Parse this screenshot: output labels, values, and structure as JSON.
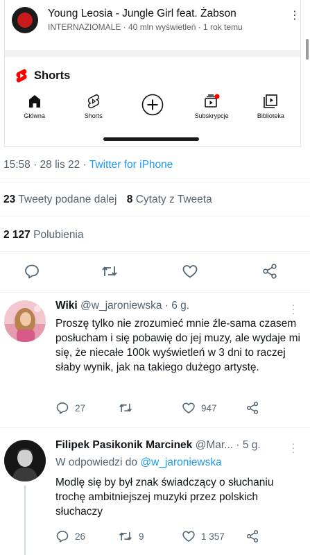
{
  "youtube": {
    "video_title": "Young Leosia - Jungle Girl feat. Żabson",
    "video_meta": "INTERNAZIOMALE · 40 mln wyświetleń · 1 rok temu",
    "shorts_label": "Shorts",
    "nav": [
      {
        "label": "Główna",
        "icon": "home-icon"
      },
      {
        "label": "Shorts",
        "icon": "shorts-icon"
      },
      {
        "label": "",
        "icon": "create-plus-icon"
      },
      {
        "label": "Subskrypcje",
        "icon": "subscriptions-icon"
      },
      {
        "label": "Biblioteka",
        "icon": "library-icon"
      }
    ]
  },
  "tweet": {
    "timestamp": "15:58 · 28 lis 22 · ",
    "source": "Twitter for iPhone",
    "retweets_count": "23",
    "retweets_label": "Tweety podane dalej",
    "quotes_count": "8",
    "quotes_label": "Cytaty z Tweeta",
    "likes_count": "2 127",
    "likes_label": "Polubienia"
  },
  "replies": [
    {
      "name": "Wiki",
      "handle": "@w_jaroniewska · 6 g.",
      "text": "Proszę tylko nie zrozumieć mnie źle-sama czasem posłucham i się pobawię do jej muzy, ale wydaje mi się, że niecałe 100k wyświetleń w 3 dni to raczej słaby wynik, jak na takiego dużego artystę.",
      "replies": "27",
      "retweets": "",
      "likes": "947"
    },
    {
      "name": "Filipek Pasikonik Marcinek",
      "handle": "@Mar... · 5 g.",
      "replying_prefix": "W odpowiedzi do ",
      "replying_to": "@w_jaroniewska",
      "text": "Modlę się by był znak świadczący o słuchaniu trochę ambitniejszej muzyki przez polskich słuchaczy",
      "replies": "26",
      "retweets": "9",
      "likes": "1 357"
    }
  ],
  "colors": {
    "accent": "#1d9bf0",
    "secondary_text": "#536471",
    "youtube_red": "#ff0000"
  }
}
